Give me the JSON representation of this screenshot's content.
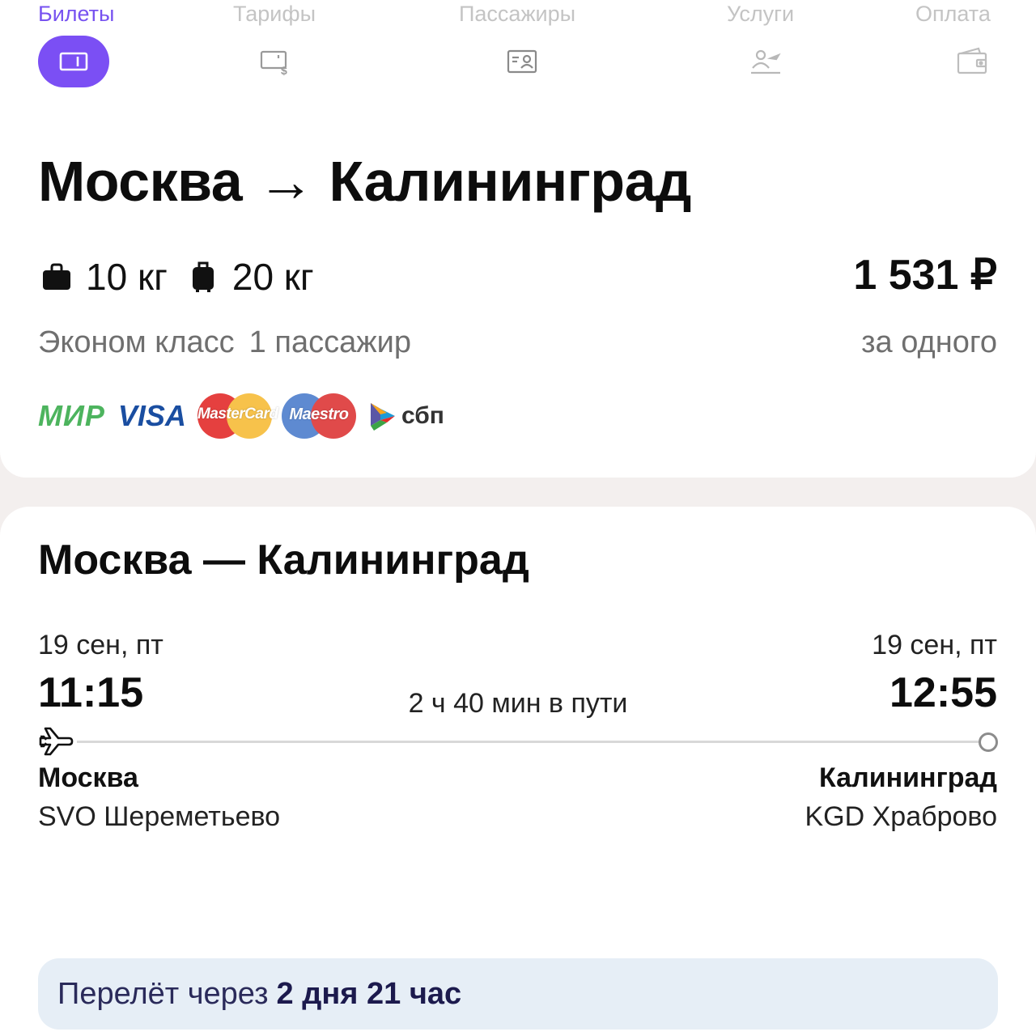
{
  "stepper": {
    "steps": [
      {
        "label": "Билеты",
        "icon": "ticket-icon",
        "active": true
      },
      {
        "label": "Тарифы",
        "icon": "tariff-icon",
        "active": false
      },
      {
        "label": "Пассажиры",
        "icon": "passport-icon",
        "active": false
      },
      {
        "label": "Услуги",
        "icon": "services-icon",
        "active": false
      },
      {
        "label": "Оплата",
        "icon": "wallet-icon",
        "active": false
      }
    ],
    "active_color": "#7b4ff4",
    "inactive_color": "#c4c4c4"
  },
  "offer": {
    "route": "Москва → Калининград",
    "cabin_bag": "10 кг",
    "checked_bag": "20 кг",
    "price": "1 531 ₽",
    "cabin_class": "Эконом класс",
    "passengers": "1 пассажир",
    "price_note": "за одного",
    "payment_methods": {
      "mir": "МИР",
      "visa": "VISA",
      "mastercard": "MasterCard",
      "maestro": "Maestro",
      "sbp": "сбп"
    }
  },
  "flight": {
    "title": "Москва — Калининград",
    "departure": {
      "date": "19 сен, пт",
      "time": "11:15",
      "city": "Москва",
      "airport": "SVO Шереметьево"
    },
    "arrival": {
      "date": "19 сен, пт",
      "time": "12:55",
      "city": "Калининград",
      "airport": "KGD Храброво"
    },
    "duration": "2 ч 40 мин в пути"
  },
  "notice": {
    "prefix": "Перелёт через",
    "value": "2 дня 21 час"
  }
}
